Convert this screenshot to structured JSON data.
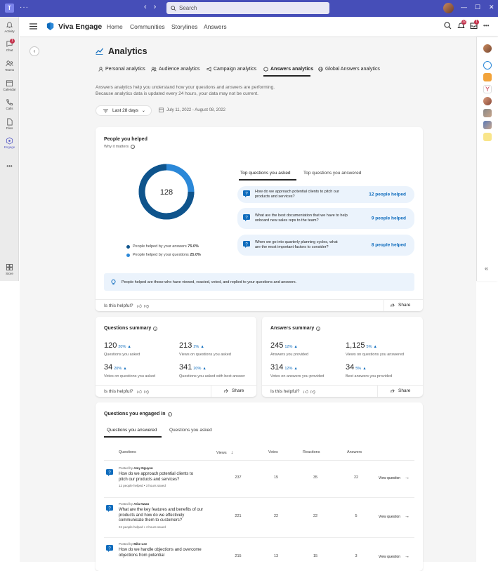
{
  "titlebar": {
    "search_placeholder": "Search"
  },
  "rail": {
    "items": [
      {
        "label": "Activity",
        "icon": "bell-icon"
      },
      {
        "label": "Chat",
        "icon": "chat-icon",
        "badge": "1"
      },
      {
        "label": "Teams",
        "icon": "teams-icon"
      },
      {
        "label": "Calendar",
        "icon": "calendar-icon"
      },
      {
        "label": "Calls",
        "icon": "phone-icon"
      },
      {
        "label": "Files",
        "icon": "file-icon"
      },
      {
        "label": "Engage",
        "icon": "engage-icon"
      },
      {
        "label": "Store",
        "icon": "store-icon"
      }
    ],
    "more": "•••"
  },
  "header": {
    "app_name": "Viva Engage",
    "nav": [
      "Home",
      "Communities",
      "Storylines",
      "Answers"
    ],
    "notif_badge": "12",
    "inbox_badge": "1",
    "more": "•••"
  },
  "page": {
    "title": "Analytics",
    "tabs": [
      "Personal analytics",
      "Audience analytics",
      "Campaign analytics",
      "Answers analytics",
      "Global Answers analytics"
    ],
    "active_tab": "Answers analytics",
    "description_1": "Answers analytics help you understand how your questions and answers are performing.",
    "description_2": "Because analytics data is updated every 24 hours, your data may not be current.",
    "date_filter": "Last 28 days",
    "date_range": "July 11, 2022 - August 08, 2022"
  },
  "people_helped": {
    "title": "People you helped",
    "why": "Why it matters",
    "total": "128",
    "answers_pct": 75,
    "legend_answers_label": "People helped by your answers",
    "legend_answers_value": "75.0%",
    "legend_questions_label": "People helped by your questions",
    "legend_questions_value": "25.0%",
    "colors": {
      "answers": "#0f548c",
      "questions": "#2b88d8"
    },
    "tab_asked": "Top questions you asked",
    "tab_answered": "Top questions you answered",
    "top_questions": [
      {
        "text": "How do we approach potential clients to pitch our products and services?",
        "helped": "12 people helped"
      },
      {
        "text": "What are the best documentation that we have to help onboard new sales reps to the team?",
        "helped": "9 people helped"
      },
      {
        "text": "When we go into quarterly planning cycles, what are the most important factors to consider?",
        "helped": "8 people helped"
      }
    ],
    "info": "People helped are those who have viewed, reacted, voted, and replied to your questions and answers.",
    "helpful": "Is this helpful?",
    "share": "Share"
  },
  "questions_summary": {
    "title": "Questions summary",
    "stats": [
      {
        "value": "120",
        "change": "20%",
        "label": "Questions you asked"
      },
      {
        "value": "213",
        "change": "2%",
        "label": "Views on questions you asked"
      },
      {
        "value": "34",
        "change": "20%",
        "label": "Votes on questions you asked"
      },
      {
        "value": "341",
        "change": "20%",
        "label": "Questions you asked with best answer"
      }
    ],
    "helpful": "Is this helpful?",
    "share": "Share"
  },
  "answers_summary": {
    "title": "Answers summary",
    "stats": [
      {
        "value": "245",
        "change": "12%",
        "label": "Answers you provided"
      },
      {
        "value": "1,125",
        "change": "5%",
        "label": "Views on questions you answered"
      },
      {
        "value": "314",
        "change": "12%",
        "label": "Votes on answers you provided"
      },
      {
        "value": "34",
        "change": "5%",
        "label": "Best answers you provided"
      }
    ],
    "helpful": "Is this helpful?",
    "share": "Share"
  },
  "engaged": {
    "title": "Questions you engaged in",
    "tab_answered": "Questions you answered",
    "tab_asked": "Questions you asked",
    "columns": {
      "questions": "Questions",
      "views": "Views",
      "votes": "Votes",
      "reactions": "Reactions",
      "answers": "Answers"
    },
    "view_label": "View question",
    "posted_prefix": "Posted by",
    "rows": [
      {
        "author": "Amy Nguyen",
        "text": "How do we approach potential clients to pitch our products and services?",
        "meta": "12 people helped  •  3 hours saved",
        "views": "237",
        "votes": "15",
        "reactions": "35",
        "answers": "22"
      },
      {
        "author": "Aria Kwan",
        "text": "What are the key features and benefits of our products and how do we effectively communicate them to customers?",
        "meta": "24 people helped  •  4 hours saved",
        "views": "221",
        "votes": "22",
        "reactions": "22",
        "answers": "5"
      },
      {
        "author": "Mike Lee",
        "text": "How do we handle objections and overcome objections from potential",
        "meta": "",
        "views": "215",
        "votes": "13",
        "reactions": "15",
        "answers": "3"
      }
    ]
  }
}
